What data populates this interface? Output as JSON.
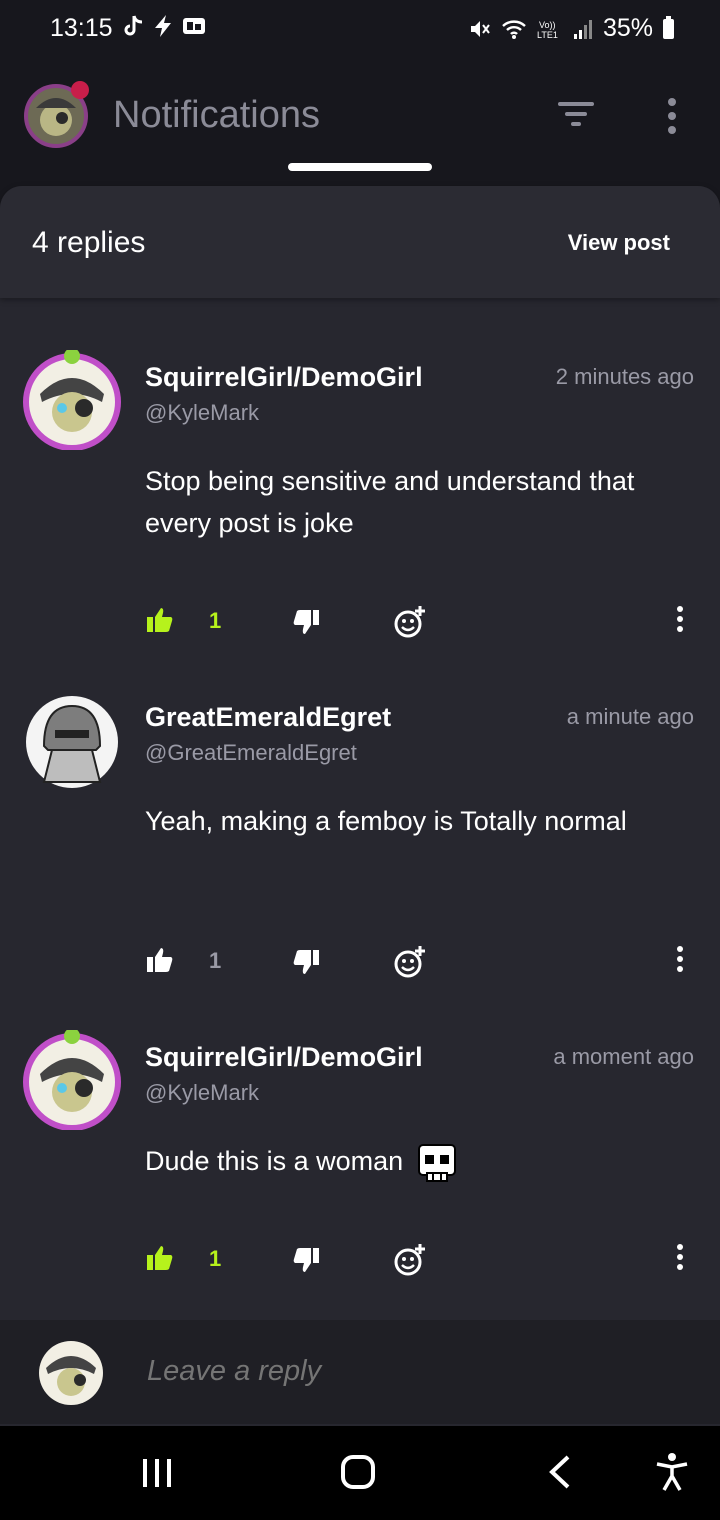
{
  "status_bar": {
    "time": "13:15",
    "battery": "35%"
  },
  "header": {
    "title": "Notifications"
  },
  "sheet": {
    "replies_count": "4 replies",
    "view_post_label": "View post"
  },
  "comments": [
    {
      "name": "SquirrelGirl/DemoGirl",
      "handle": "@KyleMark",
      "time": "2 minutes ago",
      "text": "Stop being sensitive and understand that every post is joke",
      "likes": "1",
      "liked": true
    },
    {
      "name": "GreatEmeraldEgret",
      "handle": "@GreatEmeraldEgret",
      "time": "a minute ago",
      "text": "Yeah, making a femboy is Totally normal",
      "likes": "1",
      "liked": false
    },
    {
      "name": "SquirrelGirl/DemoGirl",
      "handle": "@KyleMark",
      "time": "a moment ago",
      "text": "Dude this is a woman",
      "likes": "1",
      "liked": true
    }
  ],
  "reply_bar": {
    "placeholder": "Leave a reply"
  },
  "colors": {
    "liked": "#b6f21c",
    "avatar_ring": "#c04fc8",
    "unliked": "#9a9aa6"
  }
}
